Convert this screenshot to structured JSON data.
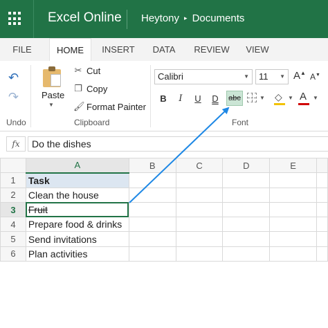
{
  "titlebar": {
    "app_name": "Excel Online",
    "breadcrumb_user": "Heytony",
    "breadcrumb_sep": "▸",
    "breadcrumb_folder": "Documents"
  },
  "tabs": [
    {
      "label": "FILE",
      "active": false
    },
    {
      "label": "HOME",
      "active": true
    },
    {
      "label": "INSERT",
      "active": false
    },
    {
      "label": "DATA",
      "active": false
    },
    {
      "label": "REVIEW",
      "active": false
    },
    {
      "label": "VIEW",
      "active": false
    }
  ],
  "ribbon": {
    "undo_group_label": "Undo",
    "clipboard": {
      "paste_label": "Paste",
      "cut_label": "Cut",
      "copy_label": "Copy",
      "format_painter_label": "Format Painter",
      "group_label": "Clipboard"
    },
    "font": {
      "font_name": "Calibri",
      "font_size": "11",
      "grow_label": "A",
      "shrink_label": "A",
      "bold_label": "B",
      "italic_label": "I",
      "underline_label": "U",
      "double_underline_label": "D",
      "strikethrough_label": "abc",
      "font_color_label": "A",
      "group_label": "Font",
      "strikethrough_active": true,
      "fill_color": "#f2c200",
      "font_color": "#d00000"
    }
  },
  "formula_bar": {
    "fx_label": "fx",
    "value": "Do the dishes"
  },
  "grid": {
    "columns": [
      "A",
      "B",
      "C",
      "D",
      "E"
    ],
    "rows": [
      {
        "num": "1",
        "a": "Task"
      },
      {
        "num": "2",
        "a": "Clean the house"
      },
      {
        "num": "3",
        "a": "Fruit"
      },
      {
        "num": "4",
        "a": "Prepare food & drinks"
      },
      {
        "num": "5",
        "a": "Send invitations"
      },
      {
        "num": "6",
        "a": "Plan activities"
      }
    ],
    "active_cell": "A3"
  },
  "colors": {
    "brand": "#217346",
    "arrow": "#1e88e5",
    "header_fill": "#dce6f1"
  }
}
